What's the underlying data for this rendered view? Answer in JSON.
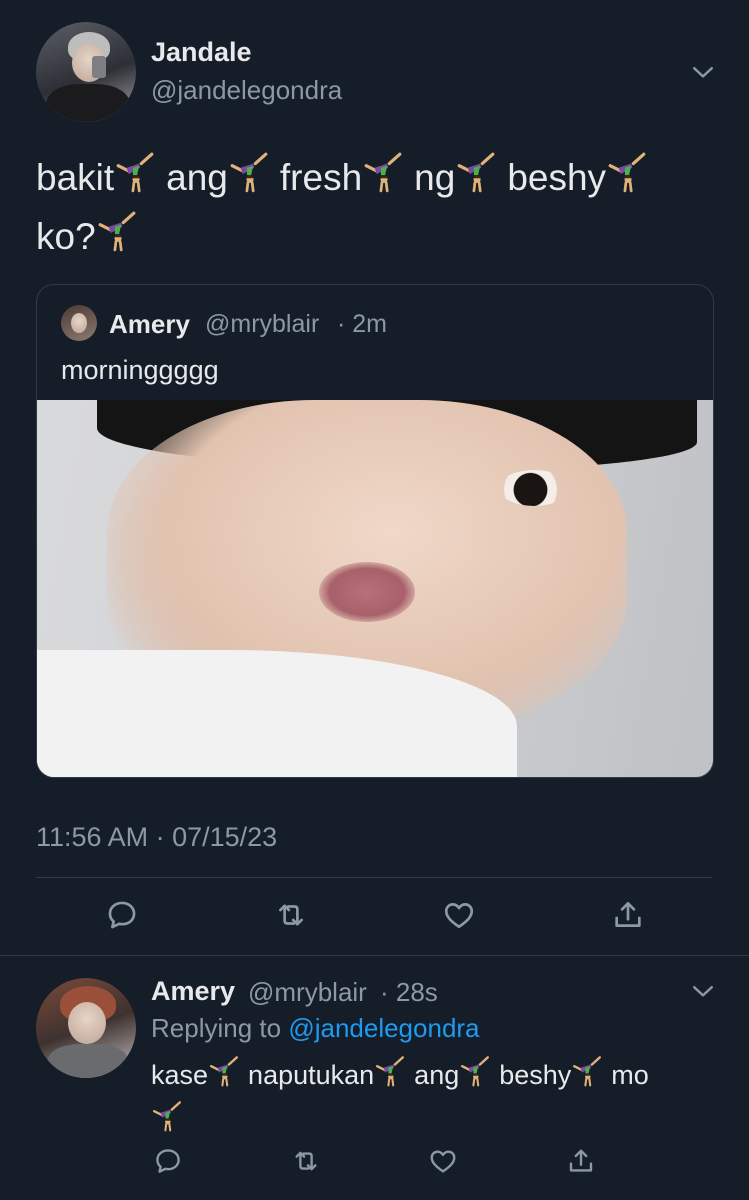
{
  "tweet": {
    "author_name": "Jandale",
    "author_handle": "@jandelegondra",
    "text_line1": [
      "bakit",
      "ang",
      "fresh",
      "ng",
      "beshy"
    ],
    "text_line2": [
      "ko?"
    ],
    "timestamp": "11:56 AM · 07/15/23"
  },
  "quoted": {
    "author_name": "Amery",
    "author_handle": "@mryblair",
    "time": "· 2m",
    "text": "morninggggg"
  },
  "reply": {
    "author_name": "Amery",
    "author_handle": "@mryblair",
    "time": "· 28s",
    "replying_to_label": "Replying to",
    "replying_to_handle": "@jandelegondra",
    "text_line1": [
      "kase",
      "naputukan",
      "ang",
      "beshy",
      "mo"
    ]
  },
  "icons": {
    "options": "chevron-down-icon",
    "reply": "reply-icon",
    "retweet": "retweet-icon",
    "like": "like-icon",
    "share": "share-icon",
    "emoji": "cartwheel-emoji"
  },
  "colors": {
    "background": "#151d28",
    "text": "#e7e9ea",
    "muted": "#8b98a5",
    "link": "#1d9bf0",
    "border": "#2f3b48"
  }
}
